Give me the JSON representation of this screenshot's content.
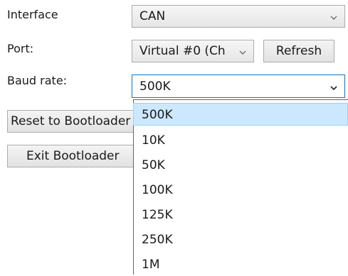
{
  "interface": {
    "label": "Interface",
    "value": "CAN"
  },
  "port": {
    "label": "Port:",
    "value": "Virtual #0 (Ch",
    "refresh_label": "Refresh"
  },
  "baud": {
    "label": "Baud rate:",
    "value": "500K",
    "options": [
      "500K",
      "10K",
      "50K",
      "100K",
      "125K",
      "250K",
      "1M"
    ],
    "selected_index": 0
  },
  "buttons": {
    "reset_label": "Reset to Bootloader",
    "exit_label": "Exit Bootloader"
  },
  "colors": {
    "selected_option_bg": "#cce8ff",
    "selected_option_border": "#99d1ff",
    "focused_combo_border": "#0078d7"
  }
}
